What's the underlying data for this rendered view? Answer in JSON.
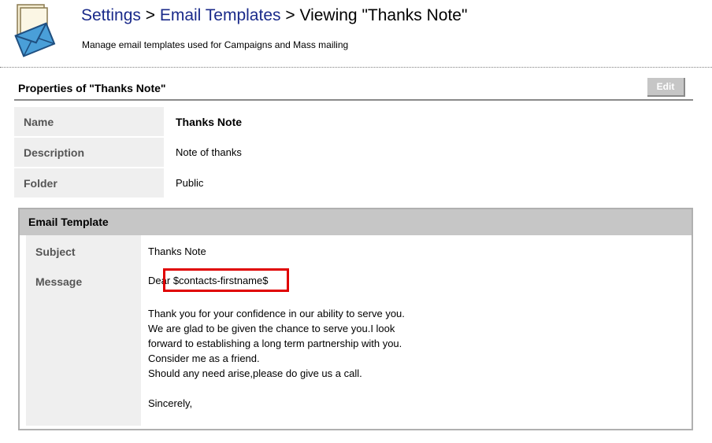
{
  "header": {
    "icon": "email-template-icon",
    "breadcrumb": {
      "settings": "Settings",
      "sep1": " > ",
      "email_templates": "Email Templates",
      "sep2": " > ",
      "current": "Viewing \"Thanks Note\""
    },
    "subtitle": "Manage email templates used for Campaigns and Mass mailing"
  },
  "properties": {
    "title": "Properties of \"Thanks Note\"",
    "edit_label": "Edit",
    "rows": [
      {
        "label": "Name",
        "value": "Thanks Note"
      },
      {
        "label": "Description",
        "value": "Note of thanks"
      },
      {
        "label": "Folder",
        "value": "Public"
      }
    ]
  },
  "template": {
    "title": "Email Template",
    "subject_label": "Subject",
    "subject_value": "Thanks Note",
    "message_label": "Message",
    "greeting": "Dear",
    "variable": "$contacts-firstname$",
    "body_lines": [
      "Thank you for your confidence in our ability to serve you.",
      "We are glad to be given the chance to serve you.I look",
      "forward to establishing a long term partnership with you.",
      "Consider me as a friend.",
      "Should any need arise,please do give us a call."
    ],
    "closing": "Sincerely,"
  },
  "colors": {
    "breadcrumb_link": "#1a2a8a",
    "highlight_border": "#e00000",
    "label_bg": "#efefef",
    "header_bg": "#c6c6c6"
  }
}
